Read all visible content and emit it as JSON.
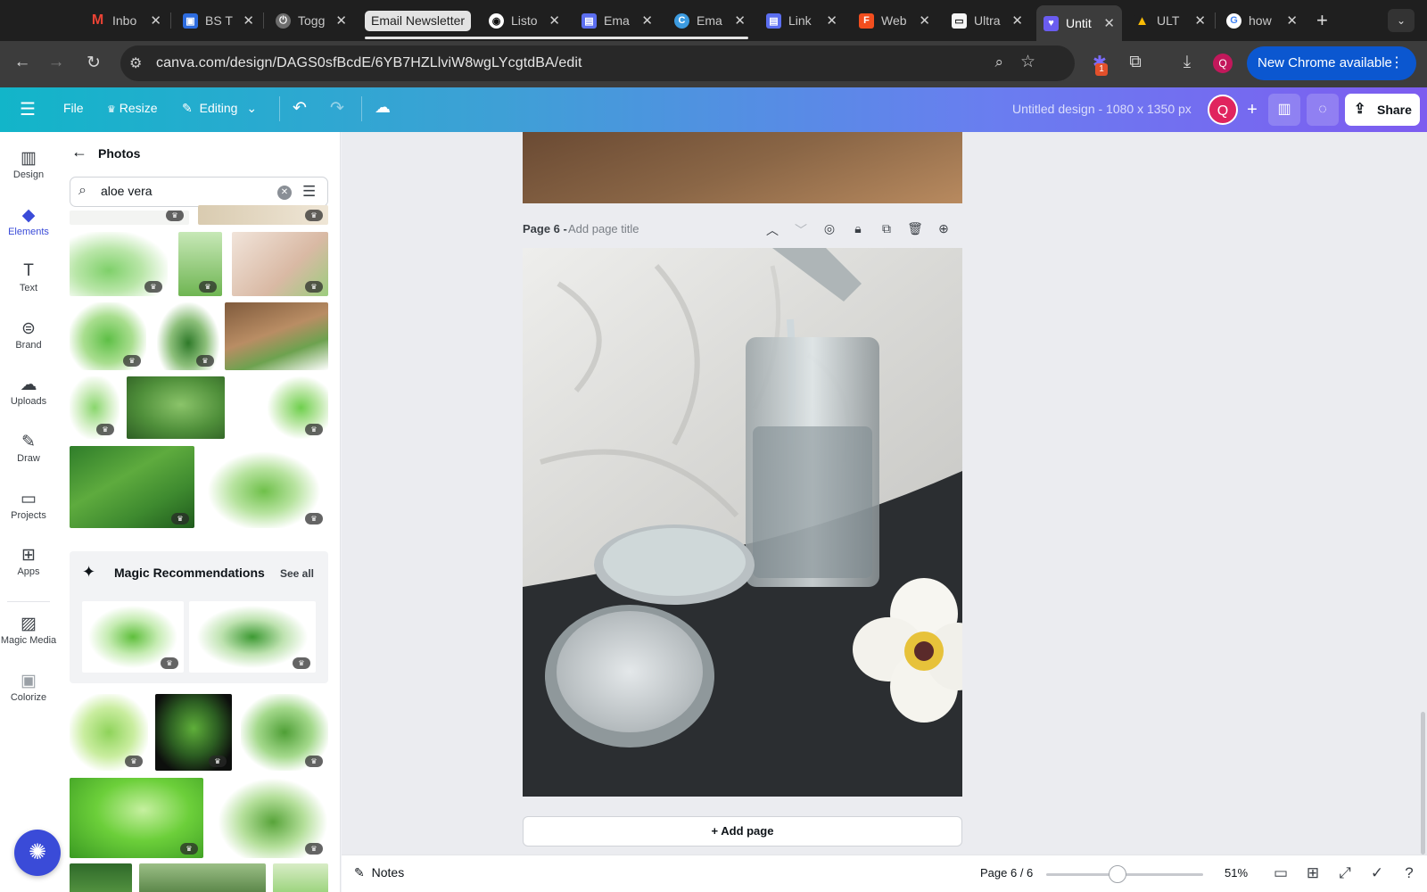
{
  "browser": {
    "tabs": [
      {
        "label": "Inbo",
        "icon": "gmail-icon",
        "color": "#ea4335",
        "glyph": "M"
      },
      {
        "label": "BS T",
        "icon": "trello-icon",
        "color": "#2d6cdf",
        "glyph": "▣"
      },
      {
        "label": "Togg",
        "icon": "toggl-icon",
        "color": "#8a8a8a",
        "glyph": "⏻"
      },
      {
        "label": "Email Newsletter",
        "icon": "group-chip",
        "color": "#e3e3e3",
        "glyph": ""
      },
      {
        "label": "Listo",
        "icon": "notion-icon",
        "color": "#ffffff",
        "glyph": "◉"
      },
      {
        "label": "Ema",
        "icon": "doc-icon",
        "color": "#5b6ef0",
        "glyph": "▤"
      },
      {
        "label": "Ema",
        "icon": "canva-icon",
        "color": "#3c9be0",
        "glyph": "C"
      },
      {
        "label": "Link",
        "icon": "doc-icon",
        "color": "#5b6ef0",
        "glyph": "▤"
      },
      {
        "label": "Web",
        "icon": "figma-icon",
        "color": "#f24e1e",
        "glyph": "F"
      },
      {
        "label": "Ultra",
        "icon": "page-icon",
        "color": "#f5f5f5",
        "glyph": "▭"
      },
      {
        "label": "Untit",
        "icon": "canva-heart-icon",
        "color": "#6a5cf0",
        "glyph": "♥"
      },
      {
        "label": "ULT",
        "icon": "drive-icon",
        "color": "#1fa463",
        "glyph": "▲"
      },
      {
        "label": "how",
        "icon": "google-icon",
        "color": "#ffffff",
        "glyph": "G"
      }
    ],
    "url": "canva.com/design/DAGS0sfBcdE/6YB7HZLlviW8wgLYcgtdBA/edit",
    "extension_badge": "1",
    "profile_initial": "Q",
    "update_label": "New Chrome available"
  },
  "canva_header": {
    "file": "File",
    "resize": "Resize",
    "editing": "Editing",
    "design_title": "Untitled design - 1080 x 1350 px",
    "avatar_initial": "Q",
    "share": "Share"
  },
  "rail": {
    "items": [
      {
        "label": "Design",
        "icon": "design-icon",
        "glyph": "▥"
      },
      {
        "label": "Elements",
        "icon": "elements-icon",
        "glyph": "◆"
      },
      {
        "label": "Text",
        "icon": "text-icon",
        "glyph": "T"
      },
      {
        "label": "Brand",
        "icon": "brand-icon",
        "glyph": "⊜"
      },
      {
        "label": "Uploads",
        "icon": "uploads-icon",
        "glyph": "☁"
      },
      {
        "label": "Draw",
        "icon": "draw-icon",
        "glyph": "✎"
      },
      {
        "label": "Projects",
        "icon": "projects-icon",
        "glyph": "▭"
      },
      {
        "label": "Apps",
        "icon": "apps-icon",
        "glyph": "⊞"
      },
      {
        "label": "Magic Media",
        "icon": "magic-media-icon",
        "glyph": "▨"
      },
      {
        "label": "Colorize",
        "icon": "colorize-icon",
        "glyph": "▣"
      }
    ]
  },
  "panel": {
    "title": "Photos",
    "search_value": "aloe vera",
    "magic_title": "Magic Recommendations",
    "see_all": "See all"
  },
  "editor": {
    "page_label": "Page 6 -",
    "page_title_placeholder": "Add page title",
    "add_page": "+ Add page"
  },
  "bottom": {
    "notes": "Notes",
    "page_counter": "Page 6 / 6",
    "zoom": "51%",
    "zoom_level": 0.51
  },
  "colors": {
    "accent": "#3a4bd8",
    "chrome_update": "#0b57d0",
    "avatar": "#e0245e"
  }
}
